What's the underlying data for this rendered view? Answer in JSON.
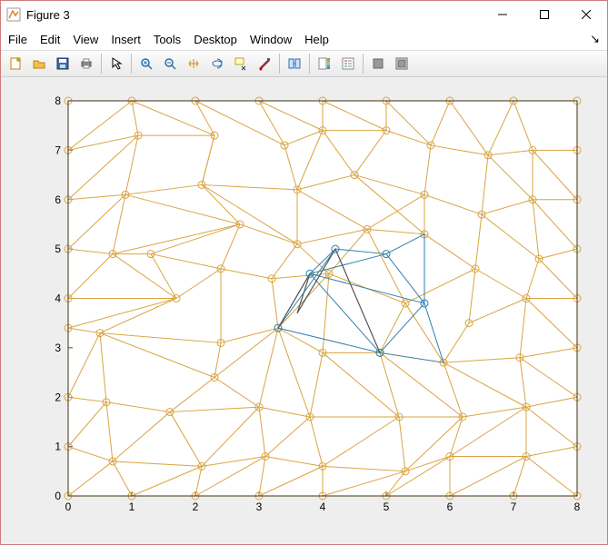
{
  "window": {
    "title": "Figure 3",
    "minimize_label": "Minimize",
    "maximize_label": "Maximize",
    "close_label": "Close"
  },
  "menubar": {
    "file": "File",
    "edit": "Edit",
    "view": "View",
    "insert": "Insert",
    "tools": "Tools",
    "desktop": "Desktop",
    "window": "Window",
    "help": "Help"
  },
  "toolbar_icons": {
    "new": "new-icon",
    "open": "open-icon",
    "save": "save-icon",
    "print": "print-icon",
    "pointer": "pointer-icon",
    "zoom_in": "zoom-in-icon",
    "zoom_out": "zoom-out-icon",
    "pan": "pan-icon",
    "rotate3d": "rotate-3d-icon",
    "data_cursor": "data-cursor-icon",
    "brush": "brush-icon",
    "link": "link-plots-icon",
    "colorbar": "insert-colorbar-icon",
    "legend": "insert-legend-icon",
    "hide": "hide-plot-tools-icon",
    "show": "show-plot-tools-icon"
  },
  "chart_data": {
    "type": "scatter",
    "title": "",
    "xlabel": "",
    "ylabel": "",
    "xlim": [
      0,
      8
    ],
    "ylim": [
      0,
      8
    ],
    "xticks": [
      0,
      1,
      2,
      3,
      4,
      5,
      6,
      7,
      8
    ],
    "yticks": [
      0,
      1,
      2,
      3,
      4,
      5,
      6,
      7,
      8
    ],
    "colors": {
      "mesh": "#d9a441",
      "highlight": "#2f7fb0",
      "dark": "#555"
    },
    "nodes": [
      [
        0.0,
        0.0
      ],
      [
        1.0,
        0.0
      ],
      [
        2.0,
        0.0
      ],
      [
        3.0,
        0.0
      ],
      [
        4.0,
        0.0
      ],
      [
        5.0,
        0.0
      ],
      [
        6.0,
        0.0
      ],
      [
        7.0,
        0.0
      ],
      [
        8.0,
        0.0
      ],
      [
        0.0,
        1.0
      ],
      [
        0.0,
        2.0
      ],
      [
        0.0,
        3.4
      ],
      [
        0.0,
        4.0
      ],
      [
        0.0,
        5.0
      ],
      [
        0.0,
        6.0
      ],
      [
        0.0,
        7.0
      ],
      [
        0.0,
        8.0
      ],
      [
        8.0,
        1.0
      ],
      [
        8.0,
        2.0
      ],
      [
        8.0,
        3.0
      ],
      [
        8.0,
        4.0
      ],
      [
        8.0,
        5.0
      ],
      [
        8.0,
        6.0
      ],
      [
        8.0,
        7.0
      ],
      [
        8.0,
        8.0
      ],
      [
        1.0,
        8.0
      ],
      [
        2.0,
        8.0
      ],
      [
        3.0,
        8.0
      ],
      [
        4.0,
        8.0
      ],
      [
        5.0,
        8.0
      ],
      [
        6.0,
        8.0
      ],
      [
        7.0,
        8.0
      ],
      [
        0.7,
        0.7
      ],
      [
        2.1,
        0.6
      ],
      [
        3.1,
        0.8
      ],
      [
        4.0,
        0.6
      ],
      [
        5.3,
        0.5
      ],
      [
        6.0,
        0.8
      ],
      [
        7.2,
        0.8
      ],
      [
        0.6,
        1.9
      ],
      [
        0.5,
        3.3
      ],
      [
        0.7,
        4.9
      ],
      [
        0.9,
        6.1
      ],
      [
        1.1,
        7.3
      ],
      [
        1.6,
        1.7
      ],
      [
        2.3,
        2.4
      ],
      [
        3.0,
        1.8
      ],
      [
        3.8,
        1.6
      ],
      [
        5.2,
        1.6
      ],
      [
        6.2,
        1.6
      ],
      [
        7.2,
        1.8
      ],
      [
        2.4,
        3.1
      ],
      [
        1.7,
        4.0
      ],
      [
        1.3,
        4.9
      ],
      [
        2.4,
        4.6
      ],
      [
        2.7,
        5.5
      ],
      [
        2.1,
        6.3
      ],
      [
        2.3,
        7.3
      ],
      [
        3.3,
        3.4
      ],
      [
        3.2,
        4.4
      ],
      [
        3.6,
        5.1
      ],
      [
        3.6,
        6.2
      ],
      [
        3.4,
        7.1
      ],
      [
        4.0,
        2.9
      ],
      [
        4.1,
        4.5
      ],
      [
        4.7,
        5.4
      ],
      [
        4.5,
        6.5
      ],
      [
        5.0,
        7.4
      ],
      [
        4.0,
        7.4
      ],
      [
        4.9,
        2.9
      ],
      [
        5.3,
        3.9
      ],
      [
        5.6,
        5.3
      ],
      [
        5.6,
        6.1
      ],
      [
        5.7,
        7.1
      ],
      [
        5.9,
        2.7
      ],
      [
        6.3,
        3.5
      ],
      [
        6.4,
        4.6
      ],
      [
        6.5,
        5.7
      ],
      [
        6.6,
        6.9
      ],
      [
        7.1,
        2.8
      ],
      [
        7.2,
        4.0
      ],
      [
        7.4,
        4.8
      ],
      [
        7.3,
        6.0
      ],
      [
        7.3,
        7.0
      ]
    ],
    "mesh_edges": [
      [
        0,
        1
      ],
      [
        1,
        2
      ],
      [
        2,
        3
      ],
      [
        3,
        4
      ],
      [
        4,
        5
      ],
      [
        5,
        6
      ],
      [
        6,
        7
      ],
      [
        7,
        8
      ],
      [
        0,
        9
      ],
      [
        9,
        10
      ],
      [
        10,
        11
      ],
      [
        11,
        12
      ],
      [
        12,
        13
      ],
      [
        13,
        14
      ],
      [
        14,
        15
      ],
      [
        15,
        16
      ],
      [
        8,
        17
      ],
      [
        17,
        18
      ],
      [
        18,
        19
      ],
      [
        19,
        20
      ],
      [
        20,
        21
      ],
      [
        21,
        22
      ],
      [
        22,
        23
      ],
      [
        23,
        24
      ],
      [
        16,
        25
      ],
      [
        25,
        26
      ],
      [
        26,
        27
      ],
      [
        27,
        28
      ],
      [
        28,
        29
      ],
      [
        29,
        30
      ],
      [
        30,
        31
      ],
      [
        31,
        24
      ],
      [
        0,
        32
      ],
      [
        1,
        32
      ],
      [
        1,
        33
      ],
      [
        2,
        33
      ],
      [
        2,
        34
      ],
      [
        3,
        34
      ],
      [
        3,
        35
      ],
      [
        4,
        35
      ],
      [
        4,
        36
      ],
      [
        5,
        36
      ],
      [
        5,
        37
      ],
      [
        6,
        37
      ],
      [
        6,
        38
      ],
      [
        7,
        38
      ],
      [
        8,
        38
      ],
      [
        9,
        32
      ],
      [
        9,
        39
      ],
      [
        32,
        39
      ],
      [
        32,
        33
      ],
      [
        33,
        34
      ],
      [
        34,
        35
      ],
      [
        35,
        36
      ],
      [
        36,
        37
      ],
      [
        37,
        38
      ],
      [
        10,
        39
      ],
      [
        39,
        44
      ],
      [
        32,
        44
      ],
      [
        33,
        44
      ],
      [
        33,
        46
      ],
      [
        34,
        46
      ],
      [
        34,
        47
      ],
      [
        35,
        47
      ],
      [
        35,
        48
      ],
      [
        36,
        48
      ],
      [
        36,
        49
      ],
      [
        37,
        49
      ],
      [
        37,
        50
      ],
      [
        38,
        50
      ],
      [
        17,
        38
      ],
      [
        17,
        50
      ],
      [
        44,
        45
      ],
      [
        44,
        46
      ],
      [
        45,
        46
      ],
      [
        45,
        51
      ],
      [
        46,
        47
      ],
      [
        47,
        48
      ],
      [
        48,
        49
      ],
      [
        49,
        50
      ],
      [
        10,
        40
      ],
      [
        11,
        40
      ],
      [
        39,
        40
      ],
      [
        40,
        45
      ],
      [
        40,
        51
      ],
      [
        40,
        52
      ],
      [
        11,
        52
      ],
      [
        12,
        52
      ],
      [
        12,
        41
      ],
      [
        41,
        52
      ],
      [
        52,
        53
      ],
      [
        41,
        53
      ],
      [
        13,
        41
      ],
      [
        45,
        58
      ],
      [
        51,
        58
      ],
      [
        51,
        54
      ],
      [
        52,
        54
      ],
      [
        53,
        54
      ],
      [
        54,
        59
      ],
      [
        58,
        59
      ],
      [
        54,
        55
      ],
      [
        53,
        55
      ],
      [
        41,
        55
      ],
      [
        13,
        42
      ],
      [
        14,
        42
      ],
      [
        41,
        42
      ],
      [
        42,
        55
      ],
      [
        42,
        56
      ],
      [
        55,
        56
      ],
      [
        55,
        60
      ],
      [
        56,
        60
      ],
      [
        56,
        61
      ],
      [
        60,
        61
      ],
      [
        61,
        62
      ],
      [
        56,
        57
      ],
      [
        42,
        43
      ],
      [
        43,
        57
      ],
      [
        56,
        57
      ],
      [
        14,
        43
      ],
      [
        15,
        43
      ],
      [
        15,
        25
      ],
      [
        25,
        43
      ],
      [
        25,
        57
      ],
      [
        26,
        57
      ],
      [
        26,
        62
      ],
      [
        27,
        62
      ],
      [
        27,
        68
      ],
      [
        28,
        68
      ],
      [
        62,
        68
      ],
      [
        61,
        66
      ],
      [
        66,
        68
      ],
      [
        28,
        67
      ],
      [
        68,
        67
      ],
      [
        29,
        67
      ],
      [
        46,
        58
      ],
      [
        47,
        58
      ],
      [
        47,
        63
      ],
      [
        48,
        63
      ],
      [
        58,
        63
      ],
      [
        48,
        69
      ],
      [
        49,
        69
      ],
      [
        63,
        69
      ],
      [
        58,
        64
      ],
      [
        63,
        64
      ],
      [
        59,
        64
      ],
      [
        60,
        64
      ],
      [
        59,
        60
      ],
      [
        60,
        65
      ],
      [
        64,
        65
      ],
      [
        65,
        71
      ],
      [
        64,
        70
      ],
      [
        65,
        70
      ],
      [
        69,
        70
      ],
      [
        70,
        74
      ],
      [
        69,
        74
      ],
      [
        49,
        74
      ],
      [
        50,
        74
      ],
      [
        50,
        79
      ],
      [
        18,
        50
      ],
      [
        18,
        79
      ],
      [
        74,
        79
      ],
      [
        19,
        79
      ],
      [
        74,
        75
      ],
      [
        79,
        80
      ],
      [
        75,
        80
      ],
      [
        19,
        80
      ],
      [
        20,
        80
      ],
      [
        66,
        72
      ],
      [
        65,
        72
      ],
      [
        71,
        72
      ],
      [
        71,
        76
      ],
      [
        72,
        77
      ],
      [
        76,
        77
      ],
      [
        70,
        76
      ],
      [
        75,
        76
      ],
      [
        76,
        80
      ],
      [
        80,
        81
      ],
      [
        20,
        81
      ],
      [
        21,
        81
      ],
      [
        77,
        81
      ],
      [
        66,
        67
      ],
      [
        67,
        73
      ],
      [
        29,
        73
      ],
      [
        30,
        73
      ],
      [
        72,
        73
      ],
      [
        73,
        78
      ],
      [
        77,
        78
      ],
      [
        30,
        78
      ],
      [
        31,
        78
      ],
      [
        78,
        83
      ],
      [
        31,
        83
      ],
      [
        23,
        83
      ],
      [
        78,
        82
      ],
      [
        77,
        82
      ],
      [
        81,
        82
      ],
      [
        82,
        83
      ],
      [
        21,
        82
      ],
      [
        22,
        82
      ],
      [
        22,
        83
      ],
      [
        61,
        65
      ],
      [
        66,
        71
      ],
      [
        61,
        68
      ]
    ],
    "highlight_nodes": [
      [
        3.8,
        4.5
      ],
      [
        4.2,
        5.0
      ],
      [
        5.0,
        4.9
      ],
      [
        5.6,
        3.9
      ],
      [
        4.9,
        2.9
      ],
      [
        3.3,
        3.4
      ]
    ],
    "highlight_edges": [
      [
        0,
        1
      ],
      [
        1,
        2
      ],
      [
        0,
        2
      ],
      [
        2,
        3
      ],
      [
        0,
        3
      ],
      [
        3,
        4
      ],
      [
        0,
        4
      ],
      [
        4,
        5
      ],
      [
        0,
        5
      ],
      [
        5,
        1
      ],
      [
        2,
        71
      ],
      [
        3,
        71
      ],
      [
        3,
        74
      ],
      [
        4,
        74
      ],
      [
        4,
        69
      ]
    ],
    "highlight_extra_ref_nodes": {
      "71": [
        5.6,
        5.3
      ],
      "74": [
        5.9,
        2.7
      ],
      "69": [
        4.9,
        2.9
      ]
    }
  }
}
